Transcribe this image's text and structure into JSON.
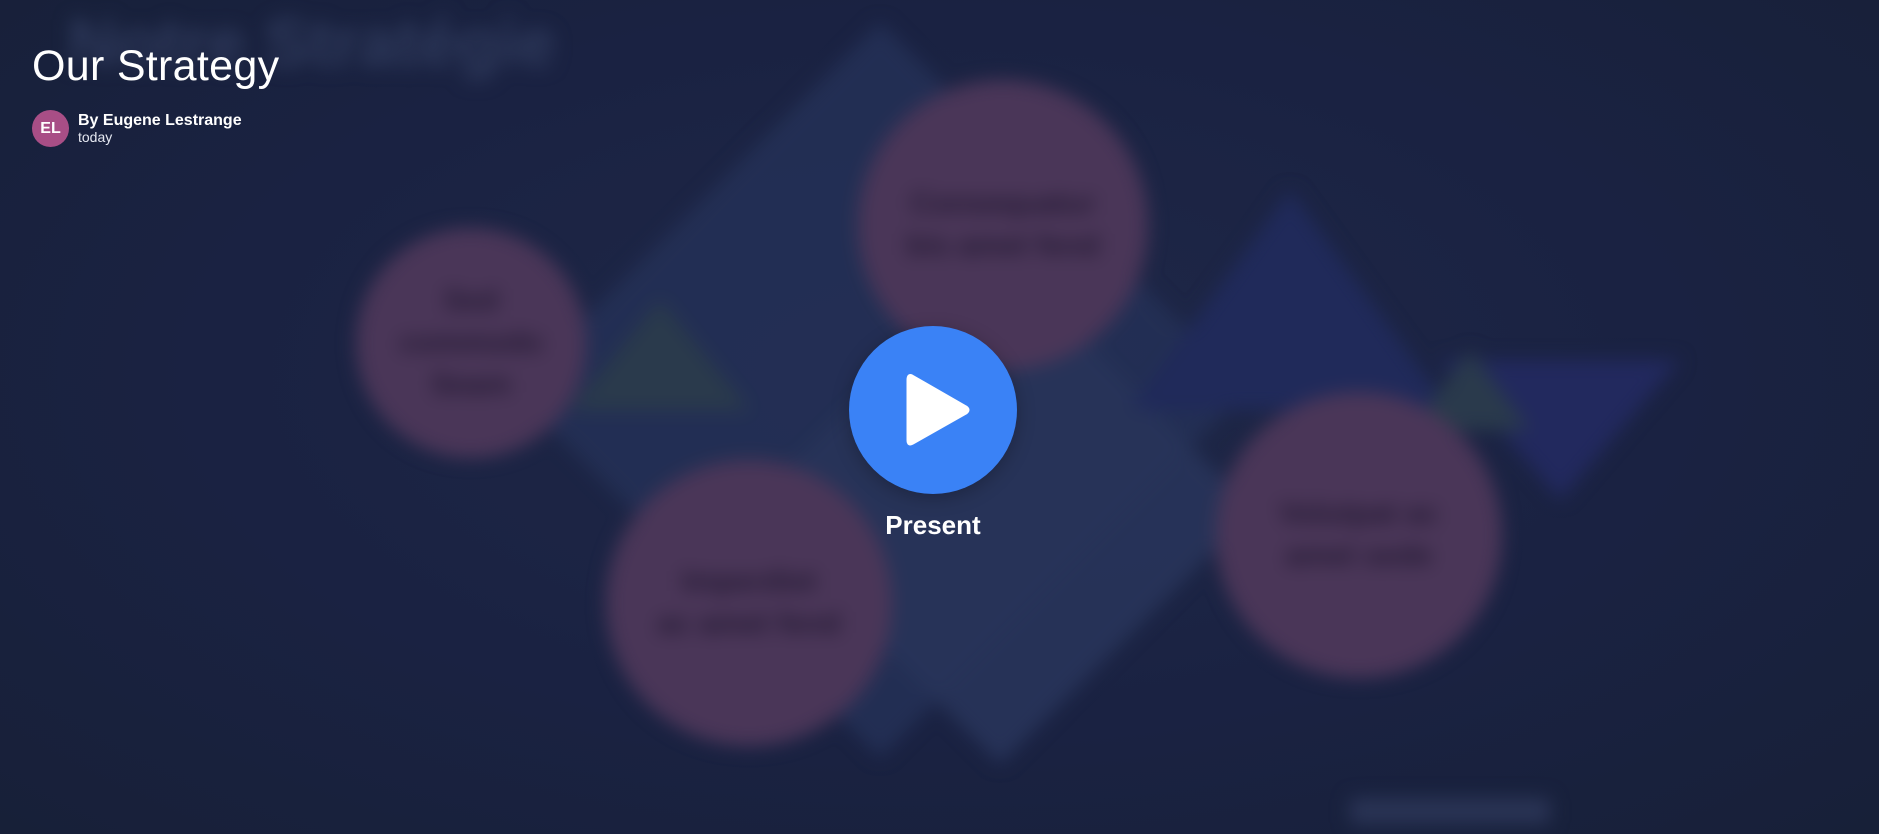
{
  "presentation": {
    "title": "Our Strategy",
    "author_byline": "By Eugene Lestrange",
    "date": "today",
    "author_initials": "EL",
    "present_label": "Present"
  },
  "icons": {
    "play": "play-icon"
  },
  "colors": {
    "background": "#1a2242",
    "avatar": "#a84e86",
    "play_button": "#3a82f6",
    "blurred_bubble": "#4a3658"
  }
}
